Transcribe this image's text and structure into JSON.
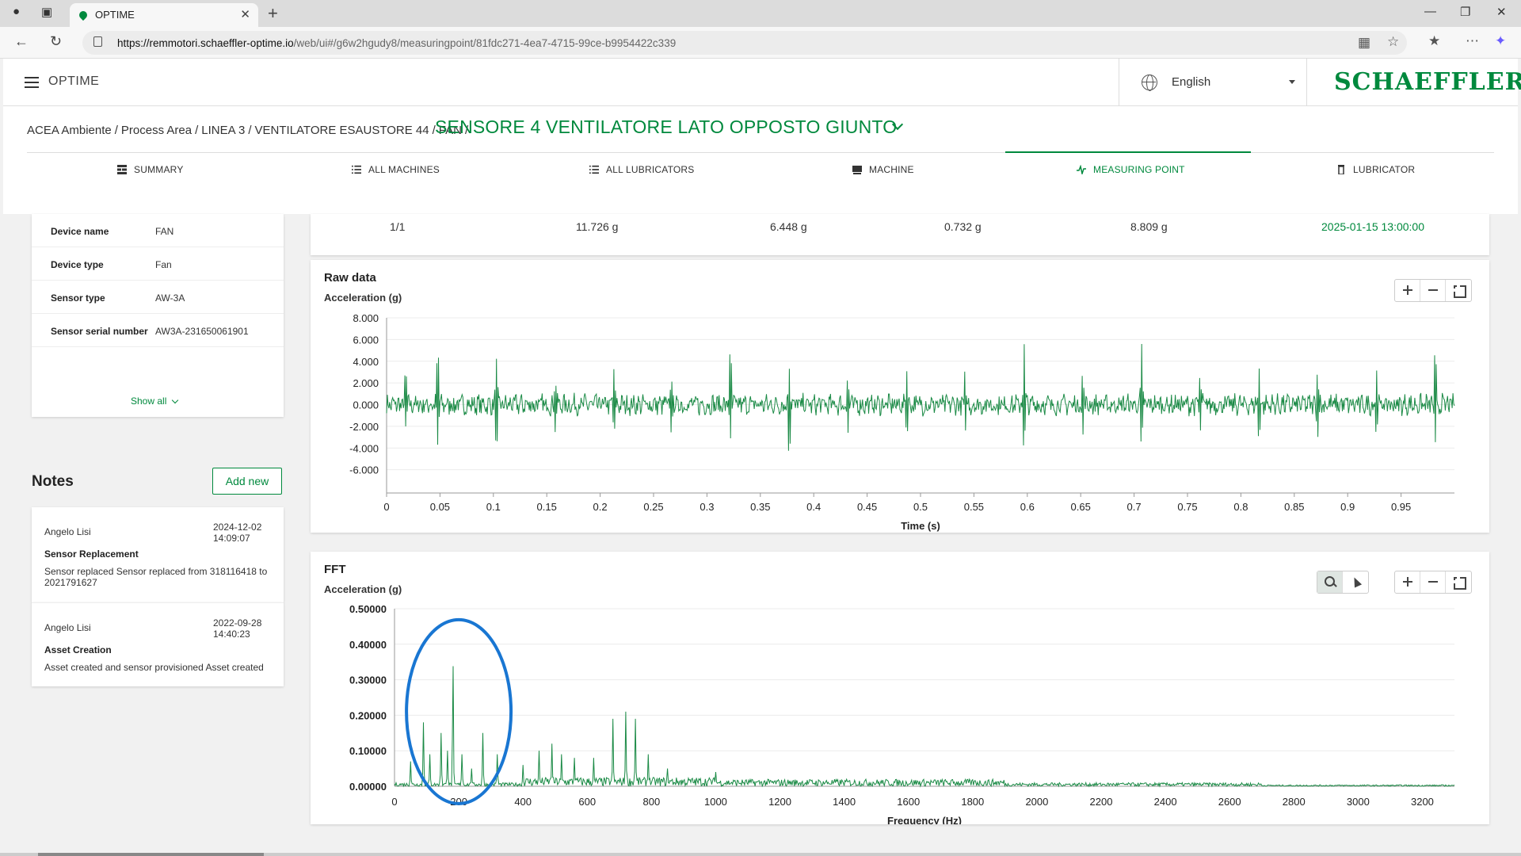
{
  "browser": {
    "tab_title": "OPTIME",
    "url_host": "https://remmotori.schaeffler-optime.io",
    "url_path": "/web/ui#/g6w2hgudy8/measuringpoint/81fdc271-4ea7-4715-99ce-b9954422c339"
  },
  "app": {
    "name": "OPTIME",
    "language": "English",
    "logo": "SCHAEFFLER",
    "brand_color": "#00893d"
  },
  "breadcrumb": {
    "items": [
      "ACEA Ambiente",
      "Process Area",
      "LINEA 3",
      "VENTILATORE ESAUSTORE 44",
      "FAN"
    ],
    "current": "SENSORE 4 VENTILATORE LATO OPPOSTO GIUNTO"
  },
  "tabs": [
    {
      "label": "SUMMARY",
      "icon": "dashboard-icon"
    },
    {
      "label": "ALL MACHINES",
      "icon": "list-icon"
    },
    {
      "label": "ALL LUBRICATORS",
      "icon": "list-icon"
    },
    {
      "label": "MACHINE",
      "icon": "machine-icon"
    },
    {
      "label": "MEASURING POINT",
      "icon": "pulse-icon",
      "active": true
    },
    {
      "label": "LUBRICATOR",
      "icon": "lubricator-icon"
    }
  ],
  "device": {
    "rows": [
      {
        "key": "Device name",
        "value": "FAN"
      },
      {
        "key": "Device type",
        "value": "Fan"
      },
      {
        "key": "Sensor type",
        "value": "AW-3A"
      },
      {
        "key": "Sensor serial number",
        "value": "AW3A-231650061901"
      }
    ],
    "show_all": "Show all"
  },
  "notes": {
    "heading": "Notes",
    "add_label": "Add new",
    "items": [
      {
        "author": "Angelo Lisi",
        "date": "2024-12-02",
        "time": "14:09:07",
        "title": "Sensor Replacement",
        "body": "Sensor replaced Sensor replaced from 318116418 to 2021791627"
      },
      {
        "author": "Angelo Lisi",
        "date": "2022-09-28",
        "time": "14:40:23",
        "title": "Asset Creation",
        "body": "Asset created and sensor provisioned Asset created"
      }
    ]
  },
  "measurement_row": {
    "index": "1/1",
    "v1": "11.726 g",
    "v2": "6.448 g",
    "v3": "0.732 g",
    "v4": "8.809 g",
    "timestamp": "2025-01-15 13:00:00"
  },
  "chart_data": [
    {
      "type": "line",
      "title": "Raw data",
      "ylabel": "Acceleration (g)",
      "xlabel": "Time (s)",
      "xlim": [
        0,
        1.0
      ],
      "ylim": [
        -8,
        8
      ],
      "yticks": [
        "8.000",
        "6.000",
        "4.000",
        "2.000",
        "0.000",
        "-2.000",
        "-4.000",
        "-6.000"
      ],
      "xticks": [
        "0",
        "0.05",
        "0.1",
        "0.15",
        "0.2",
        "0.25",
        "0.3",
        "0.35",
        "0.4",
        "0.45",
        "0.5",
        "0.55",
        "0.6",
        "0.65",
        "0.7",
        "0.75",
        "0.8",
        "0.85",
        "0.9",
        "0.95"
      ],
      "peaks": [
        {
          "x": 0.018,
          "hi": 3.5,
          "lo": -2.2
        },
        {
          "x": 0.048,
          "hi": 5.8,
          "lo": -3.8
        },
        {
          "x": 0.103,
          "hi": 3.9,
          "lo": -4.8
        },
        {
          "x": 0.158,
          "hi": 3.2,
          "lo": -2.6
        },
        {
          "x": 0.213,
          "hi": 3.0,
          "lo": -2.7
        },
        {
          "x": 0.267,
          "hi": 2.9,
          "lo": -2.8
        },
        {
          "x": 0.322,
          "hi": 6.5,
          "lo": -3.6
        },
        {
          "x": 0.377,
          "hi": 4.2,
          "lo": -5.2
        },
        {
          "x": 0.432,
          "hi": 3.1,
          "lo": -2.6
        },
        {
          "x": 0.487,
          "hi": 3.4,
          "lo": -2.6
        },
        {
          "x": 0.542,
          "hi": 3.3,
          "lo": -2.8
        },
        {
          "x": 0.597,
          "hi": 5.5,
          "lo": -4.5
        },
        {
          "x": 0.652,
          "hi": 3.4,
          "lo": -2.7
        },
        {
          "x": 0.707,
          "hi": 5.3,
          "lo": -4.8
        },
        {
          "x": 0.762,
          "hi": 3.2,
          "lo": -2.7
        },
        {
          "x": 0.817,
          "hi": 3.6,
          "lo": -3.8
        },
        {
          "x": 0.872,
          "hi": 3.9,
          "lo": -3.0
        },
        {
          "x": 0.927,
          "hi": 3.0,
          "lo": -2.8
        },
        {
          "x": 0.982,
          "hi": 5.4,
          "lo": -4.0
        }
      ],
      "series": [
        {
          "color": "#1a8a45"
        }
      ]
    },
    {
      "type": "line",
      "title": "FFT",
      "ylabel": "Acceleration (g)",
      "xlabel": "Frequency (Hz)",
      "xlim": [
        0,
        3300
      ],
      "ylim": [
        0,
        0.5
      ],
      "yticks": [
        "0.50000",
        "0.40000",
        "0.30000",
        "0.20000",
        "0.10000",
        "0.00000"
      ],
      "xticks": [
        "0",
        "200",
        "400",
        "600",
        "800",
        "1000",
        "1200",
        "1400",
        "1600",
        "1800",
        "2000",
        "2200",
        "2400",
        "2600",
        "2800",
        "3000",
        "3200"
      ],
      "peaks": [
        {
          "x": 50,
          "y": 0.07
        },
        {
          "x": 90,
          "y": 0.18
        },
        {
          "x": 110,
          "y": 0.09
        },
        {
          "x": 145,
          "y": 0.15
        },
        {
          "x": 165,
          "y": 0.1
        },
        {
          "x": 182,
          "y": 0.36
        },
        {
          "x": 210,
          "y": 0.09
        },
        {
          "x": 240,
          "y": 0.05
        },
        {
          "x": 275,
          "y": 0.15
        },
        {
          "x": 320,
          "y": 0.09
        },
        {
          "x": 400,
          "y": 0.06
        },
        {
          "x": 450,
          "y": 0.1
        },
        {
          "x": 490,
          "y": 0.12
        },
        {
          "x": 520,
          "y": 0.09
        },
        {
          "x": 560,
          "y": 0.08
        },
        {
          "x": 620,
          "y": 0.08
        },
        {
          "x": 680,
          "y": 0.19
        },
        {
          "x": 720,
          "y": 0.21
        },
        {
          "x": 750,
          "y": 0.19
        },
        {
          "x": 790,
          "y": 0.09
        },
        {
          "x": 850,
          "y": 0.05
        },
        {
          "x": 1000,
          "y": 0.04
        }
      ],
      "series": [
        {
          "color": "#1a8a45"
        }
      ],
      "annotation": {
        "type": "circle",
        "color": "#1976d2",
        "cx": 200,
        "cy": 0.21
      }
    }
  ]
}
